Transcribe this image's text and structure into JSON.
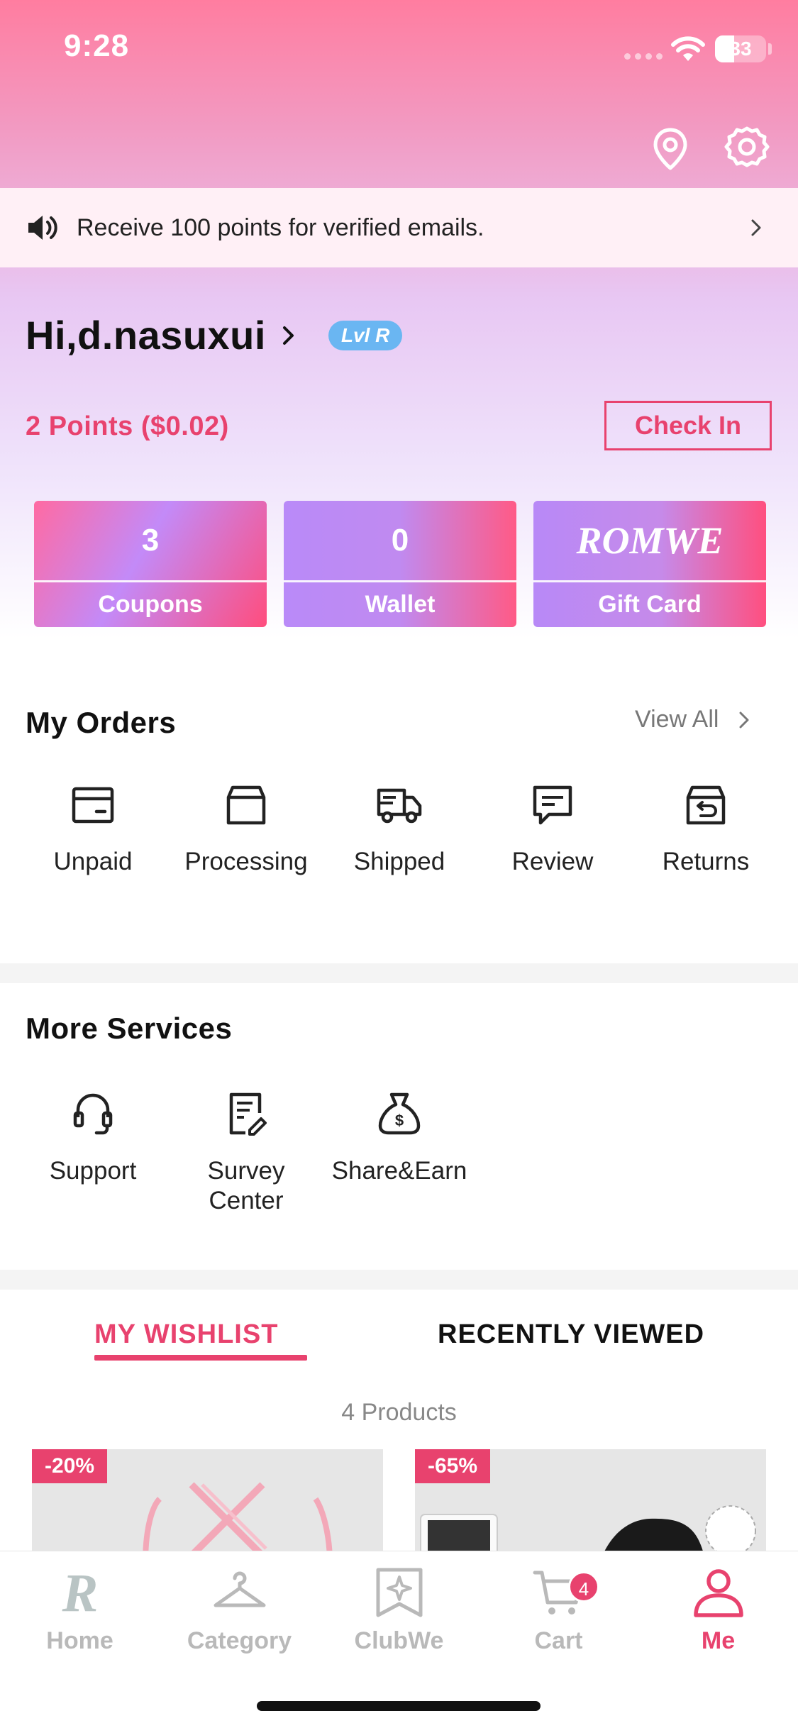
{
  "status_bar": {
    "time": "9:28",
    "battery": "33"
  },
  "announcement": {
    "text": "Receive 100 points for verified emails."
  },
  "profile": {
    "greeting": "Hi,d.nasuxui",
    "level_badge": "Lvl R"
  },
  "points": {
    "text": "2 Points ($0.02)",
    "checkin_label": "Check In"
  },
  "cards": [
    {
      "value": "3",
      "label": "Coupons"
    },
    {
      "value": "0",
      "label": "Wallet"
    },
    {
      "value": "ROMWE",
      "label": "Gift Card"
    }
  ],
  "orders": {
    "title": "My Orders",
    "view_all": "View All",
    "items": [
      {
        "label": "Unpaid",
        "icon": "wallet-icon"
      },
      {
        "label": "Processing",
        "icon": "box-icon"
      },
      {
        "label": "Shipped",
        "icon": "truck-icon"
      },
      {
        "label": "Review",
        "icon": "chat-icon"
      },
      {
        "label": "Returns",
        "icon": "return-box-icon"
      }
    ]
  },
  "services": {
    "title": "More Services",
    "items": [
      {
        "label": "Support",
        "icon": "headset-icon"
      },
      {
        "label": "Survey Center",
        "icon": "survey-icon"
      },
      {
        "label": "Share&Earn",
        "icon": "money-bag-icon"
      }
    ]
  },
  "tabs": {
    "wishlist": "MY WISHLIST",
    "recent": "RECENTLY VIEWED"
  },
  "wishlist": {
    "count_text": "4 Products",
    "products": [
      {
        "discount": "-20%"
      },
      {
        "discount": "-65%"
      }
    ]
  },
  "bottom_nav": {
    "items": [
      {
        "label": "Home",
        "icon": "romwe-r-icon"
      },
      {
        "label": "Category",
        "icon": "hanger-icon"
      },
      {
        "label": "ClubWe",
        "icon": "clubwe-icon"
      },
      {
        "label": "Cart",
        "icon": "cart-icon",
        "badge": "4"
      },
      {
        "label": "Me",
        "icon": "person-icon",
        "active": true
      }
    ]
  },
  "colors": {
    "accent": "#e8426e",
    "header_top": "#ff7da0",
    "header_mid": "#e8c7f3",
    "level_badge": "#6ab6f2",
    "inactive_nav": "#b9b9b9"
  }
}
